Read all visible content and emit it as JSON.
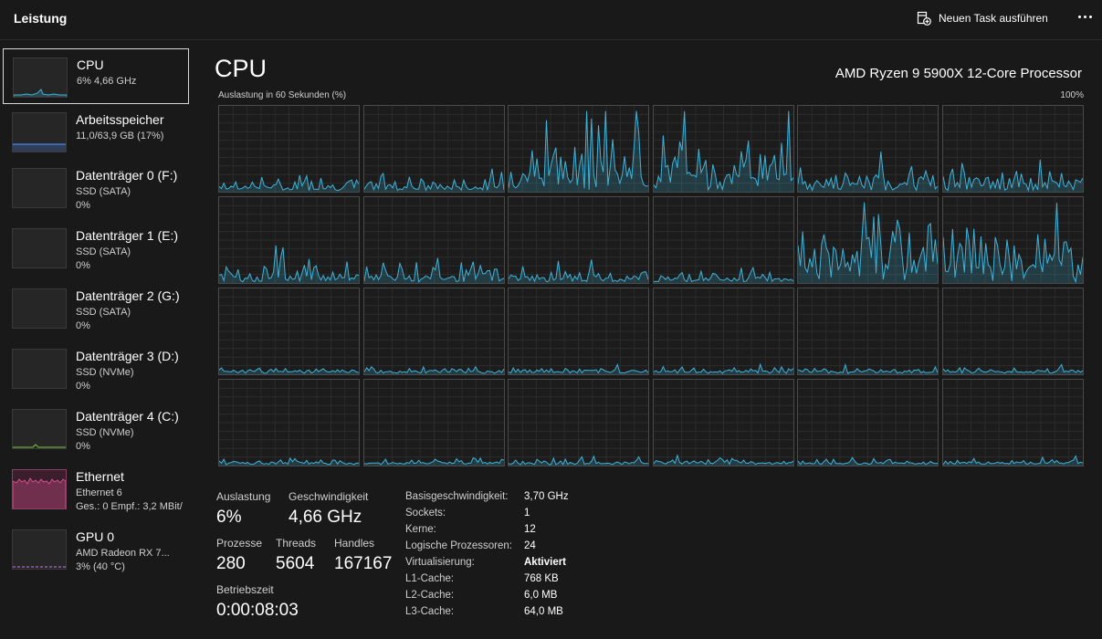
{
  "header": {
    "title": "Leistung",
    "run_task_label": "Neuen Task ausführen"
  },
  "sidebar": {
    "items": [
      {
        "title": "CPU",
        "line1": "6%  4,66 GHz",
        "line2": "",
        "active": true,
        "graph_color": "#3fb2d8"
      },
      {
        "title": "Arbeitsspeicher",
        "line1": "11,0/63,9 GB (17%)",
        "line2": "",
        "graph_color": "#4a86e8"
      },
      {
        "title": "Datenträger 0 (F:)",
        "line1": "SSD (SATA)",
        "line2": "0%",
        "graph_color": "#7cc242"
      },
      {
        "title": "Datenträger 1 (E:)",
        "line1": "SSD (SATA)",
        "line2": "0%",
        "graph_color": "#7cc242"
      },
      {
        "title": "Datenträger 2 (G:)",
        "line1": "SSD (SATA)",
        "line2": "0%",
        "graph_color": "#7cc242"
      },
      {
        "title": "Datenträger 3 (D:)",
        "line1": "SSD (NVMe)",
        "line2": "0%",
        "graph_color": "#7cc242"
      },
      {
        "title": "Datenträger 4 (C:)",
        "line1": "SSD (NVMe)",
        "line2": "0%",
        "graph_color": "#7cc242"
      },
      {
        "title": "Ethernet",
        "line1": "Ethernet 6",
        "line2": "Ges.: 0  Empf.: 3,2 MBit/",
        "graph_color": "#d4508c"
      },
      {
        "title": "GPU 0",
        "line1": "AMD Radeon RX 7...",
        "line2": "3%  (40 °C)",
        "graph_color": "#b064c8"
      }
    ]
  },
  "main": {
    "title": "CPU",
    "processor": "AMD Ryzen 9 5900X 12-Core Processor",
    "graph_label": "Auslastung in 60 Sekunden (%)",
    "graph_max": "100%",
    "accent_color": "#3fb2d8",
    "core_grid": {
      "rows": 4,
      "cols": 6
    },
    "core_levels": [
      "low",
      "low",
      "high",
      "high",
      "mid",
      "mid",
      "mid",
      "mid",
      "low",
      "low",
      "high",
      "high",
      "idle",
      "idle",
      "idle",
      "idle",
      "idle",
      "idle",
      "idle",
      "idle",
      "idle",
      "idle",
      "idle",
      "idle"
    ]
  },
  "stats": {
    "utilization": {
      "label": "Auslastung",
      "value": "6%"
    },
    "speed": {
      "label": "Geschwindigkeit",
      "value": "4,66 GHz"
    },
    "processes": {
      "label": "Prozesse",
      "value": "280"
    },
    "threads": {
      "label": "Threads",
      "value": "5604"
    },
    "handles": {
      "label": "Handles",
      "value": "167167"
    },
    "uptime": {
      "label": "Betriebszeit",
      "value": "0:00:08:03"
    }
  },
  "details": [
    {
      "key": "Basisgeschwindigkeit:",
      "value": "3,70 GHz"
    },
    {
      "key": "Sockets:",
      "value": "1"
    },
    {
      "key": "Kerne:",
      "value": "12"
    },
    {
      "key": "Logische Prozessoren:",
      "value": "24"
    },
    {
      "key": "Virtualisierung:",
      "value": "Aktiviert"
    },
    {
      "key": "L1-Cache:",
      "value": "768 KB"
    },
    {
      "key": "L2-Cache:",
      "value": "6,0 MB"
    },
    {
      "key": "L3-Cache:",
      "value": "64,0 MB"
    }
  ]
}
